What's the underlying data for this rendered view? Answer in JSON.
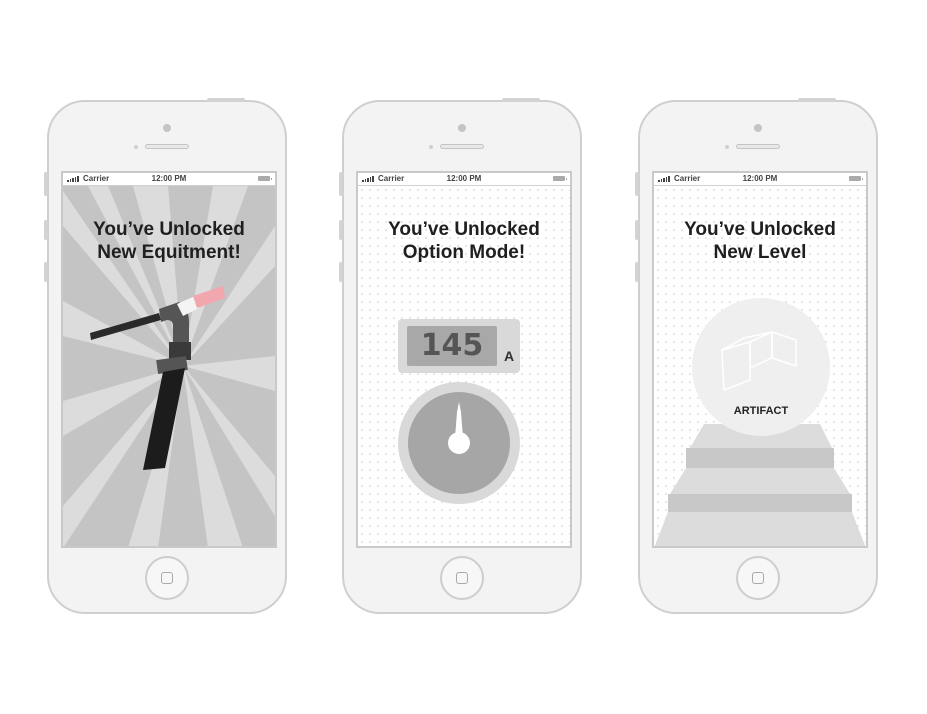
{
  "phones": [
    {
      "status": {
        "carrier": "Carrier",
        "time": "12:00 PM"
      },
      "headline": {
        "line1": "You’ve Unlocked",
        "line2": "New Equitment!"
      },
      "visual": "welding-torch-icon"
    },
    {
      "status": {
        "carrier": "Carrier",
        "time": "12:00 PM"
      },
      "headline": {
        "line1": "You’ve Unlocked",
        "line2": "Option Mode!"
      },
      "gauge": {
        "value": "145",
        "unit": "A"
      },
      "visual": "dial-gauge-icon"
    },
    {
      "status": {
        "carrier": "Carrier",
        "time": "12:00 PM"
      },
      "headline": {
        "line1": "You’ve Unlocked",
        "line2": "New Level"
      },
      "artifact_label": "ARTIFACT",
      "visual": "artifact-box-icon"
    }
  ],
  "colors": {
    "phone_body": "#f3f3f3",
    "phone_border": "#cfcfcf",
    "ray_dark": "#c4c4c4",
    "ray_light": "#dcdcdc",
    "torch_dark": "#2a2a2a",
    "torch_tip": "#f2a7ae",
    "gauge_grey": "#a8a8a8"
  }
}
